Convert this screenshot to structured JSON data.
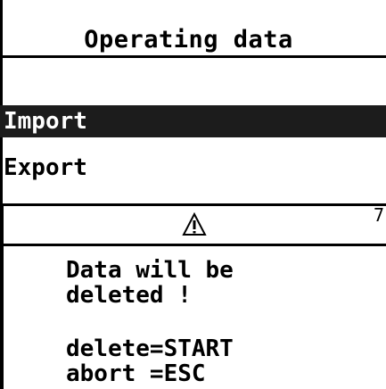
{
  "screen": {
    "title": "Operating data"
  },
  "menu": {
    "items": [
      {
        "label": "Import",
        "selected": true
      },
      {
        "label": "Export",
        "selected": false
      }
    ]
  },
  "dialog": {
    "icon": "warning-triangle-icon",
    "number": "7",
    "message_line1": "Data will be",
    "message_line2": "deleted !",
    "confirm_line": "delete=START",
    "abort_line": "abort =ESC"
  },
  "colors": {
    "background": "#ffffff",
    "foreground": "#000000",
    "selection": "#1c1c1c"
  }
}
